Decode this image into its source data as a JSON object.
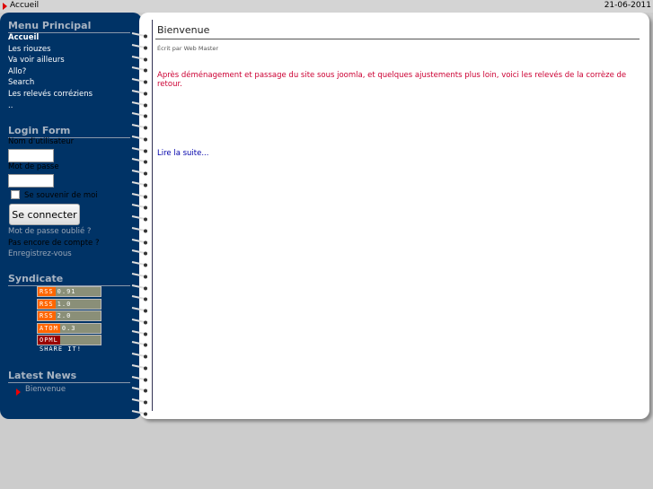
{
  "topbar": {
    "breadcrumb": "Accueil",
    "date": "21-06-2011"
  },
  "menu": {
    "title": "Menu Principal",
    "items": [
      "Accueil",
      "Les riouzes",
      "Va voir ailleurs",
      "Allo?",
      "Search",
      "Les relevés corréziens",
      ".."
    ]
  },
  "login": {
    "title": "Login Form",
    "username_label": "Nom d'utilisateur",
    "password_label": "Mot de passe",
    "remember_label": "Se souvenir de moi",
    "submit": "Se connecter",
    "forgot": "Mot de passe oublié ?",
    "no_account": "Pas encore de compte ?",
    "register": "Enregistrez-vous"
  },
  "syndicate": {
    "title": "Syndicate",
    "badges": [
      {
        "left": "RSS",
        "right": "0.91"
      },
      {
        "left": "RSS",
        "right": "1.0"
      },
      {
        "left": "RSS",
        "right": "2.0"
      },
      {
        "left": "ATOM",
        "right": "0.3"
      },
      {
        "left": "OPML",
        "right": "SHARE IT!"
      }
    ]
  },
  "latest": {
    "title": "Latest News",
    "items": [
      "Bienvenue"
    ]
  },
  "article": {
    "title": "Bienvenue",
    "author": "Écrit par Web Master",
    "text": "Après déménagement et passage du site sous joomla, et quelques ajustements plus loin, voici les relevés de la corrèze de retour.",
    "readmore": "Lire la suite..."
  },
  "colors": {
    "sidebar": "#003366",
    "accent": "#cc0033",
    "link": "#0000aa"
  }
}
